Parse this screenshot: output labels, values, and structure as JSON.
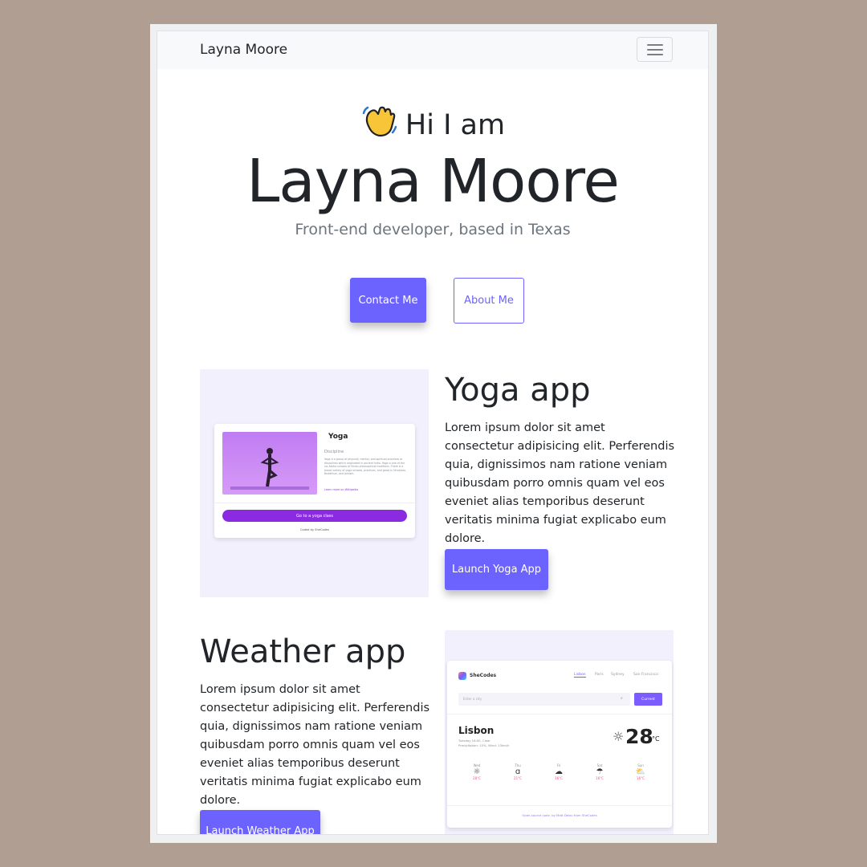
{
  "nav": {
    "brand": "Layna Moore",
    "menu_icon": "hamburger-icon"
  },
  "hero": {
    "wave_icon": "waving-hand-icon",
    "greeting": "Hi I am",
    "name": "Layna Moore",
    "subtitle": "Front-end developer, based in Texas",
    "contact_label": "Contact Me",
    "about_label": "About Me"
  },
  "projects": [
    {
      "title": "Yoga app",
      "description": "Lorem ipsum dolor sit amet consectetur adipisicing elit. Perferendis quia, dignissimos nam ratione veniam quibusdam porro omnis quam vel eos eveniet alias temporibus deserunt veritatis minima fugiat explicabo eum dolore.",
      "button_label": "Launch Yoga App",
      "preview": {
        "title": "Yoga",
        "subtitle": "Discipline",
        "body": "Yoga is a group of physical, mental, and spiritual practices or disciplines which originated in ancient India. Yoga is one of the six Astika schools of Hindu philosophical traditions. There is a broad variety of yoga schools, practices, and goals in Hinduism, Buddhism, and Jainism.",
        "link": "Learn more on Wikipedia",
        "cta": "Go to a yoga class",
        "footer": "Coded by SheCodes"
      }
    },
    {
      "title": "Weather app",
      "description": "Lorem ipsum dolor sit amet consectetur adipisicing elit. Perferendis quia, dignissimos nam ratione veniam quibusdam porro omnis quam vel eos eveniet alias temporibus deserunt veritatis minima fugiat explicabo eum dolore.",
      "button_label": "Launch Weather App",
      "preview": {
        "logo": "SheCodes",
        "tabs": [
          "Lisbon",
          "Paris",
          "Sydney",
          "San Francisco"
        ],
        "search_placeholder": "Enter a city",
        "current_label": "Current",
        "city": "Lisbon",
        "details": "Tuesday 16:00, Clear",
        "details2": "Precipitation: 15%, Wind: 13km/h",
        "temp": "28",
        "unit": "°C",
        "forecast": [
          {
            "day": "Wed",
            "icon": "sun-icon",
            "temp": "28°C"
          },
          {
            "day": "Thu",
            "icon": "wind-icon",
            "temp": "21°C"
          },
          {
            "day": "Fri",
            "icon": "cloud-icon",
            "temp": "16°C"
          },
          {
            "day": "Sat",
            "icon": "rain-icon",
            "temp": "16°C"
          },
          {
            "day": "Sun",
            "icon": "partly-cloudy-icon",
            "temp": "16°C"
          }
        ],
        "footer": "Open-source code, by Matt Delac from SheCodes"
      }
    }
  ]
}
